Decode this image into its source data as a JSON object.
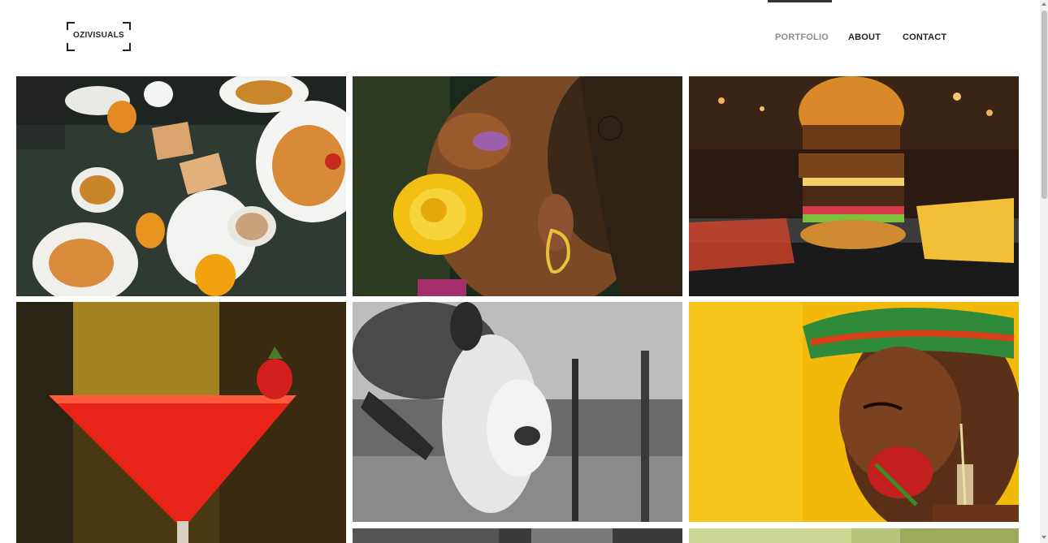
{
  "header": {
    "logo_text": "OZIVISUALS",
    "nav": [
      {
        "label": "PORTFOLIO",
        "active": true
      },
      {
        "label": "ABOUT",
        "active": false
      },
      {
        "label": "CONTACT",
        "active": false
      }
    ]
  },
  "gallery": {
    "images": [
      {
        "subject": "breakfast-table"
      },
      {
        "subject": "woman-yellow-rose-profile"
      },
      {
        "subject": "stacked-burger-fries"
      },
      {
        "subject": "red-cocktail-strawberry"
      },
      {
        "subject": "maternity-black-white"
      },
      {
        "subject": "woman-headwrap-red-rose"
      },
      {
        "subject": "black-white-partial"
      },
      {
        "subject": "green-bokeh-partial"
      }
    ]
  },
  "colors": {
    "nav_active": "#8a8a8a",
    "nav_text": "#222222",
    "background": "#ffffff"
  }
}
